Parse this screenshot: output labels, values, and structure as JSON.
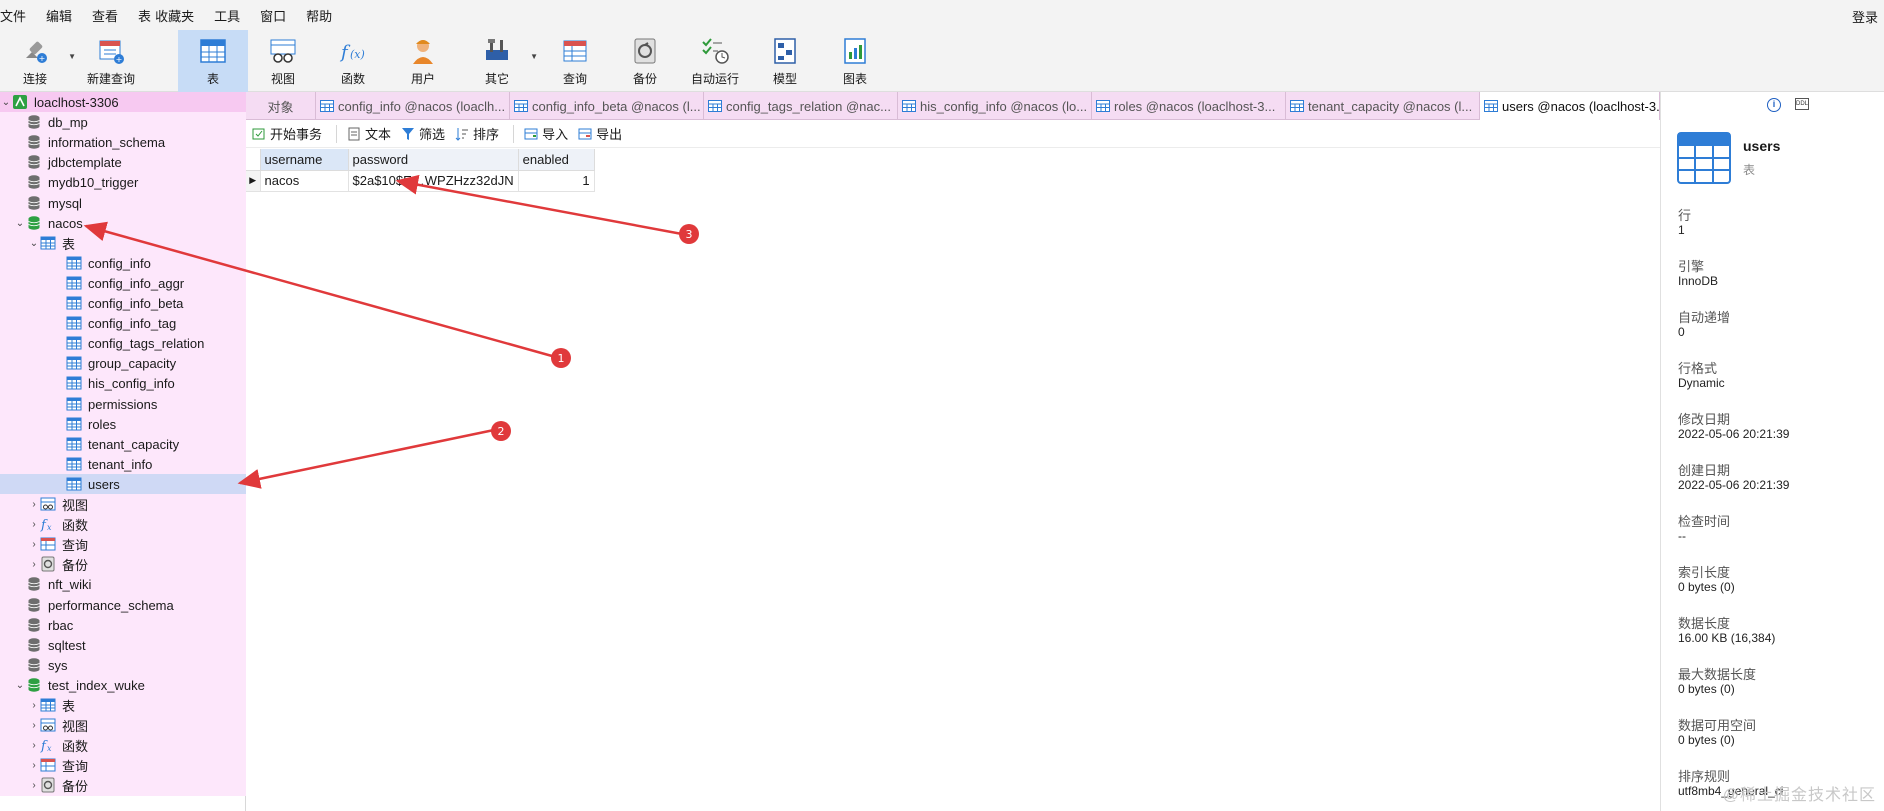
{
  "menu": {
    "items": [
      "文件",
      "编辑",
      "查看",
      "表",
      "收藏夹",
      "工具",
      "窗口",
      "帮助"
    ],
    "login": "登录"
  },
  "toolbar": {
    "connect": "连接",
    "new_query": "新建查询",
    "table": "表",
    "view": "视图",
    "function": "函数",
    "user": "用户",
    "other": "其它",
    "query": "查询",
    "backup": "备份",
    "auto_run": "自动运行",
    "model": "模型",
    "chart": "图表"
  },
  "tree": {
    "connection": "loaclhost-3306",
    "databases": [
      "db_mp",
      "information_schema",
      "jdbctemplate",
      "mydb10_trigger",
      "mysql",
      "nacos"
    ],
    "nacos_tables_label": "表",
    "nacos_tables": [
      "config_info",
      "config_info_aggr",
      "config_info_beta",
      "config_info_tag",
      "config_tags_relation",
      "group_capacity",
      "his_config_info",
      "permissions",
      "roles",
      "tenant_capacity",
      "tenant_info",
      "users"
    ],
    "nacos_groups": [
      "视图",
      "函数",
      "查询",
      "备份"
    ],
    "more_databases": [
      "nft_wiki",
      "performance_schema",
      "rbac",
      "sqltest",
      "sys",
      "test_index_wuke"
    ],
    "wuke_groups": [
      "表",
      "视图",
      "函数",
      "查询",
      "备份"
    ]
  },
  "tabs": [
    "对象",
    "config_info @nacos (loaclh...",
    "config_info_beta @nacos (l...",
    "config_tags_relation @nac...",
    "his_config_info @nacos (lo...",
    "roles @nacos (loaclhost-3...",
    "tenant_capacity @nacos (l...",
    "users @nacos (loaclhost-3..."
  ],
  "subbar": {
    "begin_tx": "开始事务",
    "text": "文本",
    "filter": "筛选",
    "sort": "排序",
    "import": "导入",
    "export": "导出"
  },
  "grid": {
    "columns": [
      "username",
      "password",
      "enabled"
    ],
    "rows": [
      [
        "nacos",
        "$2a$10$E…WPZHzz32dJN",
        "1"
      ]
    ]
  },
  "info": {
    "name": "users",
    "kind": "表",
    "rows_label": "行",
    "rows": "1",
    "engine_label": "引擎",
    "engine": "InnoDB",
    "autoinc_label": "自动递增",
    "autoinc": "0",
    "rowformat_label": "行格式",
    "rowformat": "Dynamic",
    "modified_label": "修改日期",
    "modified": "2022-05-06 20:21:39",
    "created_label": "创建日期",
    "created": "2022-05-06 20:21:39",
    "checked_label": "检查时间",
    "checked": "--",
    "index_len_label": "索引长度",
    "index_len": "0 bytes (0)",
    "data_len_label": "数据长度",
    "data_len": "16.00 KB (16,384)",
    "max_data_len_label": "最大数据长度",
    "max_data_len": "0 bytes (0)",
    "free_label": "数据可用空间",
    "free": "0 bytes (0)",
    "collation_label": "排序规则",
    "collation": "utf8mb4_general_ci"
  },
  "annotations": [
    "1",
    "2",
    "3"
  ],
  "watermark": "@稀土掘金技术社区",
  "colors": {
    "accent": "#1e5fc2",
    "sidebar_bg": "#fde7fb",
    "tab_bg": "#f5dcf3",
    "arrow": "#e0393b",
    "db_green": "#2ea043"
  }
}
